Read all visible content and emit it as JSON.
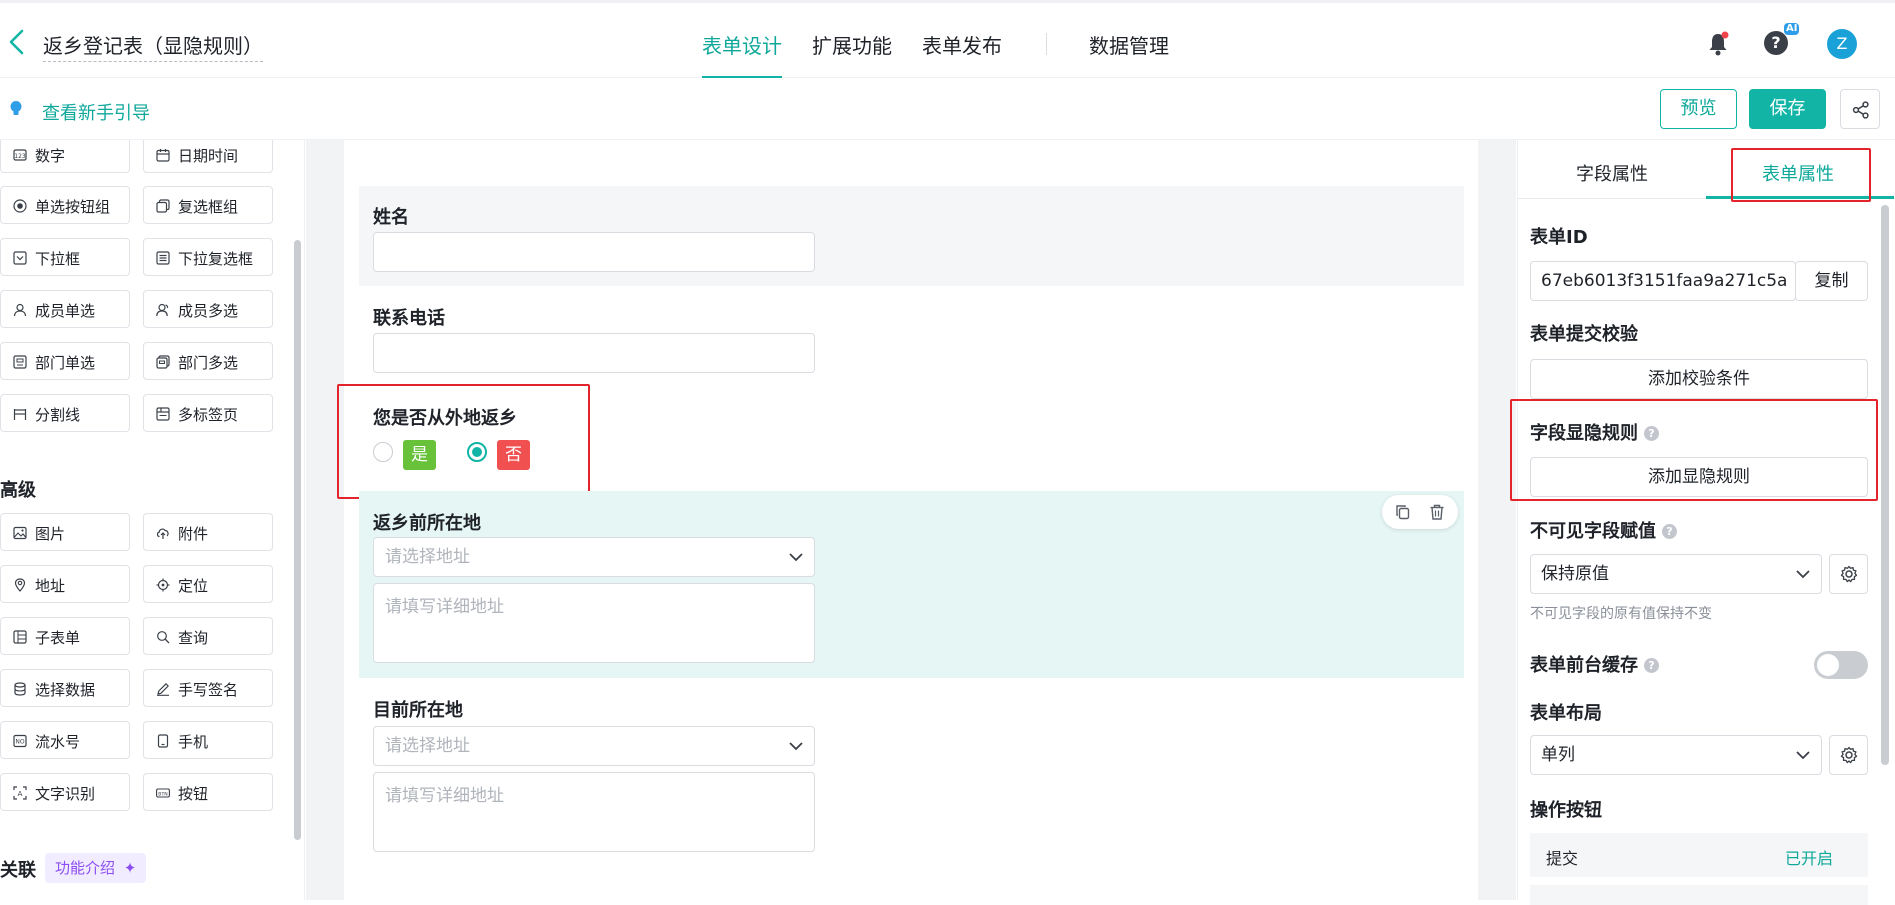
{
  "header": {
    "form_title": "返乡登记表（显隐规则）",
    "tabs": [
      {
        "label": "表单设计",
        "active": true
      },
      {
        "label": "扩展功能",
        "active": false
      },
      {
        "label": "表单发布",
        "active": false
      },
      {
        "label": "数据管理",
        "active": false
      }
    ],
    "ai_badge": "AI",
    "avatar_initial": "Z"
  },
  "toolbar": {
    "guide_link": "查看新手引导",
    "preview_label": "预览",
    "save_label": "保存"
  },
  "palette": {
    "basic_items": [
      {
        "label": "数字",
        "icon": "number-icon"
      },
      {
        "label": "日期时间",
        "icon": "calendar-icon"
      },
      {
        "label": "单选按钮组",
        "icon": "radio-icon"
      },
      {
        "label": "复选框组",
        "icon": "checkbox-group-icon"
      },
      {
        "label": "下拉框",
        "icon": "dropdown-icon"
      },
      {
        "label": "下拉复选框",
        "icon": "dropdown-multi-icon"
      },
      {
        "label": "成员单选",
        "icon": "member-icon"
      },
      {
        "label": "成员多选",
        "icon": "members-icon"
      },
      {
        "label": "部门单选",
        "icon": "department-icon"
      },
      {
        "label": "部门多选",
        "icon": "departments-icon"
      },
      {
        "label": "分割线",
        "icon": "divider-icon"
      },
      {
        "label": "多标签页",
        "icon": "tabs-icon"
      }
    ],
    "advanced_title": "高级",
    "advanced_items": [
      {
        "label": "图片",
        "icon": "image-icon"
      },
      {
        "label": "附件",
        "icon": "attachment-icon"
      },
      {
        "label": "地址",
        "icon": "location-pin-icon"
      },
      {
        "label": "定位",
        "icon": "crosshair-icon"
      },
      {
        "label": "子表单",
        "icon": "subform-icon"
      },
      {
        "label": "查询",
        "icon": "query-icon"
      },
      {
        "label": "选择数据",
        "icon": "database-icon"
      },
      {
        "label": "手写签名",
        "icon": "pen-icon"
      },
      {
        "label": "流水号",
        "icon": "serial-number-icon"
      },
      {
        "label": "手机",
        "icon": "phone-icon"
      },
      {
        "label": "文字识别",
        "icon": "ocr-icon"
      },
      {
        "label": "按钮",
        "icon": "button-icon"
      }
    ],
    "related_title": "关联",
    "intro_badge": "功能介绍"
  },
  "canvas": {
    "name_label": "姓名",
    "phone_label": "联系电话",
    "return_question": "您是否从外地返乡",
    "options": [
      {
        "label": "是",
        "checked": false,
        "color": "#67c23a"
      },
      {
        "label": "否",
        "checked": true,
        "color": "#f05050"
      }
    ],
    "prev_location_label": "返乡前所在地",
    "current_location_label": "目前所在地",
    "address_placeholder": "请选择地址",
    "detail_placeholder": "请填写详细地址"
  },
  "right_panel": {
    "tabs": [
      {
        "label": "字段属性",
        "active": false
      },
      {
        "label": "表单属性",
        "active": true
      }
    ],
    "form_id_label": "表单ID",
    "form_id_value": "67eb6013f3151faa9a271c5a",
    "copy_label": "复制",
    "validation_label": "表单提交校验",
    "add_validation": "添加校验条件",
    "visibility_label": "字段显隐规则",
    "add_visibility": "添加显隐规则",
    "invisible_label": "不可见字段赋值",
    "invisible_value": "保持原值",
    "invisible_note": "不可见字段的原有值保持不变",
    "cache_label": "表单前台缓存",
    "cache_on": false,
    "layout_label": "表单布局",
    "layout_value": "单列",
    "action_buttons_label": "操作按钮",
    "submit_label": "提交",
    "submit_status": "已开启"
  },
  "colors": {
    "accent": "#12b5a5",
    "highlight": "#e3242b"
  }
}
